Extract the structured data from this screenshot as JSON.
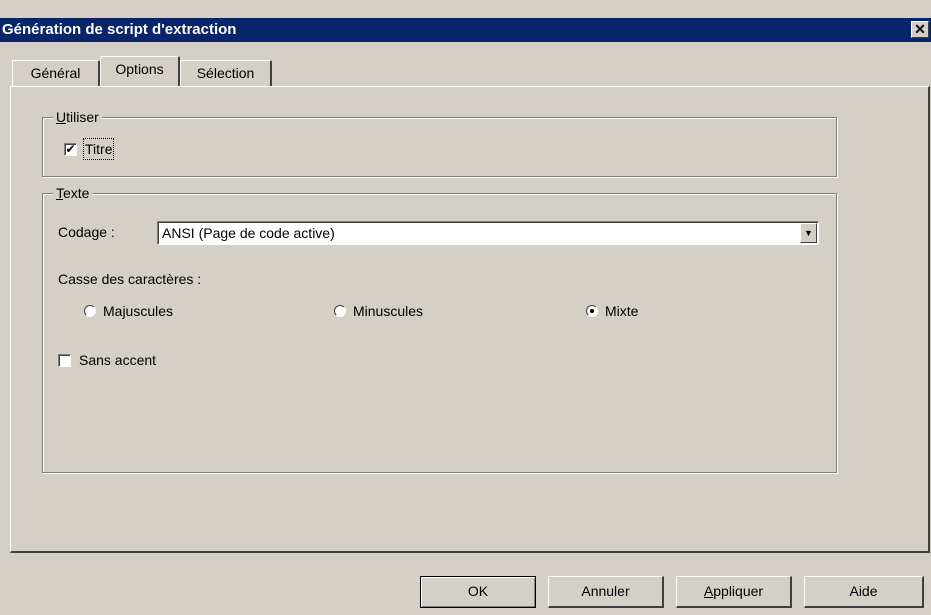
{
  "window": {
    "title": "Génération de script d'extraction",
    "close_glyph": "✕"
  },
  "tabs": [
    {
      "label": "Général"
    },
    {
      "label": "Options"
    },
    {
      "label": "Sélection"
    }
  ],
  "use_group": {
    "legend_underlined": "U",
    "legend_rest": "tiliser",
    "title_checkbox": {
      "label": "Titre",
      "checked": true,
      "check_glyph": "✔"
    }
  },
  "text_group": {
    "legend_underlined": "T",
    "legend_rest": "exte",
    "encoding_label": "Codage :",
    "encoding_value": "ANSI (Page de code active)",
    "dropdown_glyph": "▼",
    "case_label": "Casse des caractères :",
    "case_options": [
      {
        "label": "Majuscules",
        "selected": false
      },
      {
        "label": "Minuscules",
        "selected": false
      },
      {
        "label": "Mixte",
        "selected": true
      }
    ],
    "no_accent": {
      "label": "Sans accent",
      "checked": false
    }
  },
  "buttons": {
    "ok": "OK",
    "cancel": "Annuler",
    "apply_underlined": "A",
    "apply_rest": "ppliquer",
    "help": "Aide"
  },
  "colors": {
    "titlebar": "#0a246a",
    "face": "#d4d0c8"
  }
}
